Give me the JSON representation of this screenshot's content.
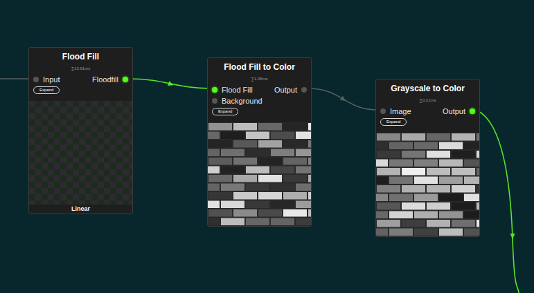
{
  "nodes": [
    {
      "title": "Flood Fill",
      "timing": "∑13.61ms",
      "inputs": [
        {
          "label": "Input",
          "active": false
        }
      ],
      "outputs": [
        {
          "label": "Floodfill",
          "active": true
        }
      ],
      "expand": "Expand",
      "preview": {
        "kind": "checker"
      },
      "footer": "Linear"
    },
    {
      "title": "Flood Fill to Color",
      "timing": "∑1.05ms",
      "inputs": [
        {
          "label": "Flood Fill",
          "active": true
        },
        {
          "label": "Background",
          "active": false
        }
      ],
      "outputs": [
        {
          "label": "Output",
          "active": false
        }
      ],
      "expand": "Expand",
      "preview": {
        "kind": "bricks"
      },
      "footer": ""
    },
    {
      "title": "Grayscale to Color",
      "timing": "∑0.21ms",
      "inputs": [
        {
          "label": "Image",
          "active": false
        }
      ],
      "outputs": [
        {
          "label": "Output",
          "active": true
        }
      ],
      "expand": "Expand",
      "preview": {
        "kind": "bricks"
      },
      "footer": ""
    }
  ],
  "edges": [
    {
      "from": "canvas",
      "to": "Flood Fill",
      "active": false
    },
    {
      "from": "Flood Fill",
      "to": "Flood Fill to Color",
      "active": true
    },
    {
      "from": "Flood Fill to Color",
      "to": "Grayscale to Color",
      "active": false
    },
    {
      "from": "Grayscale to Color",
      "to": "canvas",
      "active": true
    }
  ]
}
